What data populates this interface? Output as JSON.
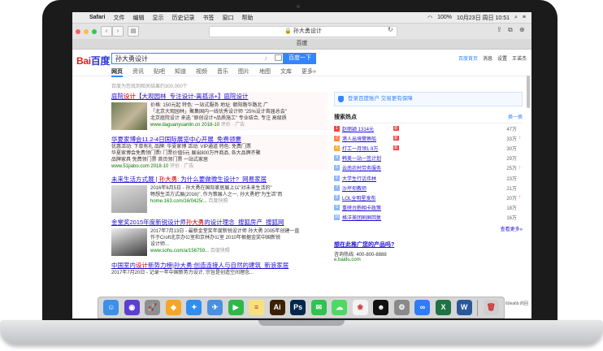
{
  "menubar": {
    "apple": "",
    "items": [
      "Safari",
      "文件",
      "编辑",
      "显示",
      "历史记录",
      "书签",
      "窗口",
      "帮助"
    ],
    "status": "100%",
    "clock": "10月23日 周日  10:51"
  },
  "browser": {
    "url": "🔒 孙大勇设计",
    "tab_title": "百度"
  },
  "baidu": {
    "logo_bai": "Bai",
    "logo_du": "百度",
    "query": "孙大勇设计",
    "search_button": "百度一下",
    "header_links": [
      "百度首页",
      "消息",
      "设置",
      "王诺杰"
    ],
    "nav": [
      "网页",
      "资讯",
      "贴吧",
      "知道",
      "视频",
      "音乐",
      "图片",
      "地图",
      "文库",
      "更多»"
    ],
    "result_count": "百度为您找到相关结果约300,000个"
  },
  "results": [
    {
      "title_pre": "庭院",
      "title_red": "设计",
      "title_post": "【大观园林_专注设计-离孤派+】庭院设计",
      "lines": [
        "价格: 150元起  特色: 一站式服务  地址: 朝阳路华路北 广",
        "「北京大观园林」聚集国内一线优秀设计师 \"25%设计首届总会\"",
        "北京庭院设计  来选 \"原创设计+品质施工\" 专业结合, 专注 高级质"
      ],
      "url": "www.daguanyuanlin.cn",
      "date": "2018-10",
      "meta": "评价 · 广告"
    },
    {
      "title_pre": "华夏家博会11.2-4日国际展览中心开展_免费领票",
      "title_red": "",
      "title_post": "",
      "lines": [
        "优惠活动: 下单有礼  品牌: 华夏家博  活动: VIP通道  特色: 免费门票",
        "华夏家博会免费领门票! 门票价值5元 展出800万件商品, 各大品牌齐聚",
        "品牌家具 免费领门票 首页领门票 一站式家居"
      ],
      "url": "www.51jiabo.com",
      "date": "2018-10",
      "meta": "评价 · 广告"
    },
    {
      "title_pre": "未来生活方式展 | ",
      "title_red": "孙大勇",
      "title_post": ": 为什么要做微生设计?_网易家居",
      "lines": [
        "2016年6月5日 - 孙大勇在国际家居展上以\"对未来生活的\"",
        "畅想生活方式展(2016)\", 作为策展人之一, 孙大勇把\"为生活\"而"
      ],
      "url": "home.163.com/16/0425/...",
      "date": "",
      "meta": "百度快照"
    },
    {
      "title_pre": "金堂奖2015年度新锐设计师",
      "title_red": "孙大勇",
      "title_post": "的设计理念_搜狐房产_搜狐网",
      "lines": [
        "2017年7月13日 - 最新金堂奖年度新锐设计师 孙大勇 2005年创建一直",
        "作于Croft北京办公室和京林办公室 2010年根据金奖中国新锐",
        "设计师..."
      ],
      "url": "www.sohu.com/a/156759...",
      "date": "",
      "meta": "百度快照"
    },
    {
      "title_pre": "中国室内",
      "title_red": "设计",
      "title_post": "新势力榜|孙大勇:创造连接人与自然的建筑_新浪家居",
      "lines": [
        "2017年7月20日 - 记录一年中国新势力设计, 宗旨是创造空间理念...",
        "孙大勇北京新锐设计师年度中国2016年获得关注设计..."
      ],
      "url": "",
      "date": "",
      "meta": ""
    }
  ],
  "sidebar": {
    "promo": "登录百度账户  交易更有保障",
    "hot_title": "搜索热点",
    "hot_refresh": "换一换",
    "hot": [
      {
        "rank": "1",
        "name": "赵丽颖 1314元",
        "tag": "新",
        "count": "47万",
        "up": false
      },
      {
        "rank": "2",
        "name": "港人出境警察船",
        "tag": "新",
        "count": "33万",
        "up": true
      },
      {
        "rank": "3",
        "name": "打工一月领1.9万",
        "tag": "新",
        "count": "30万",
        "up": false
      },
      {
        "rank": "4",
        "name": "韩美一站一签计划",
        "tag": "",
        "count": "29万",
        "up": false
      },
      {
        "rank": "5",
        "name": "云南农村劳务服务",
        "tag": "",
        "count": "25万",
        "up": true
      },
      {
        "rank": "6",
        "name": "大学生行话伟林",
        "tag": "",
        "count": "23万",
        "up": false
      },
      {
        "rank": "7",
        "name": "沙坪坝教师",
        "tag": "",
        "count": "21万",
        "up": false
      },
      {
        "rank": "8",
        "name": "LOL全明星发布",
        "tag": "",
        "count": "20万",
        "up": true
      },
      {
        "rank": "9",
        "name": "重磅台胞相卡政策",
        "tag": "",
        "count": "18万",
        "up": false
      },
      {
        "rank": "10",
        "name": "格洋美团刷屏回复",
        "tag": "",
        "count": "16万",
        "up": false
      }
    ],
    "hot_more": "查看更多»",
    "ad_question": "想在此推广您的产品吗?",
    "ad_phone": "咨询热线: 400-800-8888",
    "ad_url": "e.baidu.com"
  },
  "dock": {
    "apps": [
      {
        "name": "finder-icon",
        "glyph": "☺",
        "color": "#3d8fe8"
      },
      {
        "name": "siri-icon",
        "glyph": "◉",
        "color": "#5b3fd0"
      },
      {
        "name": "launchpad-icon",
        "glyph": "🚀",
        "color": "#8e8e93"
      },
      {
        "name": "maps-icon",
        "glyph": "◆",
        "color": "#f5a623"
      },
      {
        "name": "safari-icon",
        "glyph": "✦",
        "color": "#2f8ef0"
      },
      {
        "name": "mail-icon",
        "glyph": "✈",
        "color": "#4a90e2"
      },
      {
        "name": "facetime-icon",
        "glyph": "▶",
        "color": "#2fb84a"
      },
      {
        "name": "notes-icon",
        "glyph": "≡",
        "color": "#f7e27a"
      },
      {
        "name": "illustrator-icon",
        "glyph": "Ai",
        "color": "#3b2101"
      },
      {
        "name": "photoshop-icon",
        "glyph": "Ps",
        "color": "#00274c"
      },
      {
        "name": "wechat-icon",
        "glyph": "✉",
        "color": "#2fc34f"
      },
      {
        "name": "messages-icon",
        "glyph": "☁",
        "color": "#4cd964"
      },
      {
        "name": "photos-icon",
        "glyph": "❀",
        "color": "#f3f3f3"
      },
      {
        "name": "qq-icon",
        "glyph": "☻",
        "color": "#111111"
      },
      {
        "name": "settings-icon",
        "glyph": "⚙",
        "color": "#8a8a8a"
      },
      {
        "name": "baidu-netdisk-icon",
        "glyph": "∞",
        "color": "#2e7df6"
      },
      {
        "name": "excel-icon",
        "glyph": "X",
        "color": "#1f7244"
      },
      {
        "name": "word-icon",
        "glyph": "W",
        "color": "#2b579a"
      },
      {
        "name": "trash-icon",
        "glyph": "🗑",
        "color": "#cfcfcf"
      }
    ],
    "corner_text": "60ea6b 的回"
  }
}
